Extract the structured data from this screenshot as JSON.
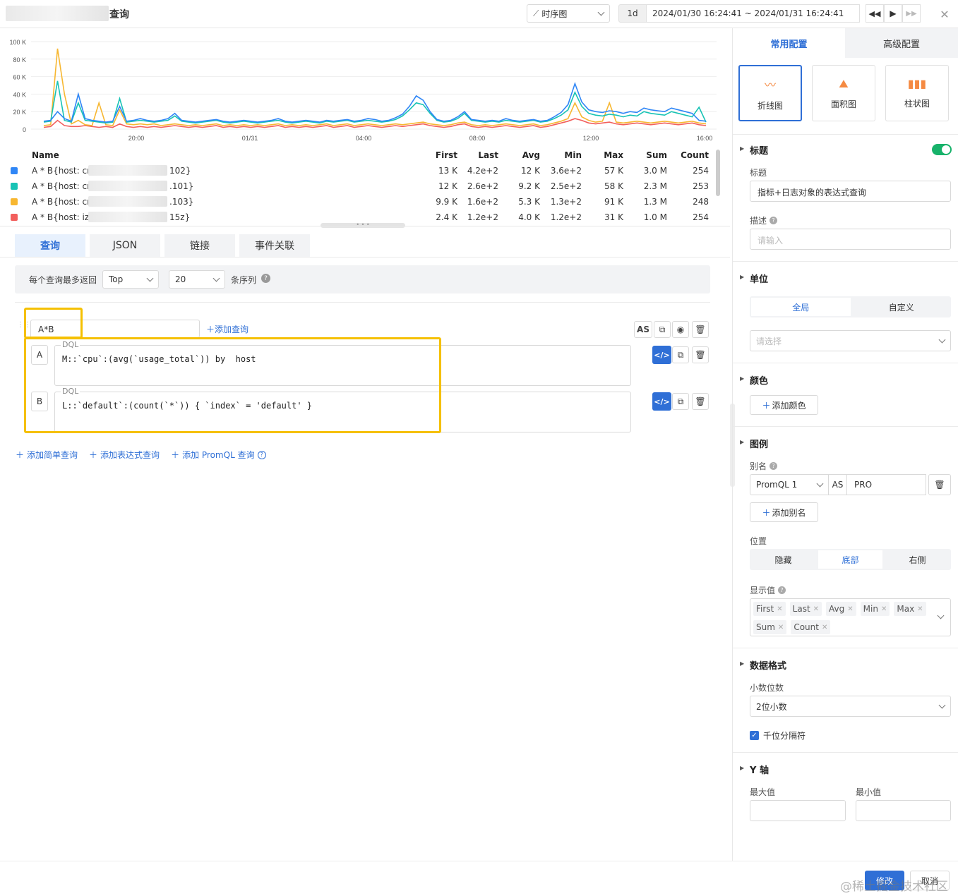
{
  "header": {
    "title": "查询",
    "chart_type": "时序图",
    "range_btn": "1d",
    "time_range": "2024/01/30 16:24:41 ~ 2024/01/31 16:24:41"
  },
  "chart_data": {
    "type": "line",
    "y_ticks": [
      "100 K",
      "80 K",
      "60 K",
      "40 K",
      "20 K",
      "0"
    ],
    "x_ticks": [
      "20:00",
      "01/31",
      "04:00",
      "08:00",
      "12:00",
      "16:00"
    ],
    "ylim": [
      0,
      100000
    ],
    "series": [
      {
        "color": "#2f86f6",
        "values": [
          9,
          10,
          20,
          12,
          9,
          40,
          12,
          10,
          9,
          8,
          9,
          26,
          9,
          10,
          12,
          10,
          9,
          10,
          12,
          18,
          10,
          9,
          8,
          9,
          10,
          11,
          9,
          8,
          9,
          10,
          9,
          8,
          9,
          10,
          12,
          9,
          8,
          9,
          10,
          9,
          8,
          10,
          9,
          10,
          11,
          9,
          10,
          12,
          11,
          9,
          10,
          13,
          17,
          26,
          38,
          33,
          20,
          11,
          9,
          10,
          14,
          20,
          11,
          10,
          9,
          10,
          9,
          12,
          10,
          9,
          10,
          11,
          9,
          10,
          14,
          19,
          28,
          52,
          31,
          22,
          20,
          19,
          21,
          20,
          18,
          20,
          19,
          24,
          22,
          21,
          20,
          24,
          22,
          20,
          18,
          10,
          9
        ]
      },
      {
        "color": "#18c3b5",
        "values": [
          8,
          9,
          55,
          10,
          8,
          30,
          10,
          9,
          8,
          7,
          8,
          35,
          8,
          9,
          10,
          9,
          8,
          9,
          10,
          15,
          9,
          8,
          7,
          8,
          9,
          10,
          8,
          7,
          8,
          9,
          8,
          7,
          8,
          9,
          10,
          8,
          7,
          8,
          9,
          8,
          7,
          9,
          8,
          9,
          10,
          8,
          9,
          10,
          9,
          8,
          9,
          11,
          15,
          22,
          30,
          28,
          18,
          10,
          8,
          9,
          12,
          18,
          10,
          9,
          8,
          9,
          8,
          10,
          9,
          8,
          9,
          10,
          8,
          9,
          12,
          16,
          22,
          42,
          26,
          18,
          16,
          15,
          17,
          16,
          14,
          16,
          15,
          20,
          18,
          17,
          16,
          20,
          18,
          16,
          14,
          25,
          8
        ]
      },
      {
        "color": "#f7b731",
        "values": [
          4,
          5,
          92,
          40,
          6,
          10,
          5,
          4,
          30,
          5,
          4,
          22,
          6,
          5,
          6,
          5,
          6,
          4,
          5,
          6,
          5,
          4,
          5,
          4,
          5,
          6,
          4,
          5,
          4,
          5,
          4,
          5,
          4,
          5,
          6,
          4,
          5,
          4,
          5,
          4,
          5,
          6,
          4,
          5,
          6,
          4,
          5,
          6,
          5,
          4,
          5,
          6,
          5,
          6,
          7,
          8,
          6,
          5,
          4,
          5,
          7,
          8,
          5,
          4,
          5,
          4,
          5,
          6,
          5,
          4,
          5,
          6,
          4,
          5,
          7,
          9,
          12,
          30,
          14,
          10,
          8,
          9,
          30,
          8,
          7,
          8,
          9,
          8,
          7,
          8,
          9,
          8,
          7,
          8,
          9,
          7,
          6
        ]
      },
      {
        "color": "#f25f5c",
        "values": [
          2,
          3,
          10,
          4,
          3,
          3,
          4,
          3,
          2,
          3,
          2,
          6,
          3,
          2,
          3,
          2,
          3,
          2,
          3,
          4,
          3,
          2,
          3,
          2,
          3,
          4,
          2,
          3,
          2,
          3,
          2,
          3,
          2,
          3,
          4,
          2,
          3,
          2,
          3,
          2,
          3,
          4,
          2,
          3,
          4,
          2,
          3,
          4,
          3,
          2,
          3,
          4,
          3,
          4,
          5,
          6,
          4,
          3,
          2,
          3,
          5,
          6,
          3,
          2,
          3,
          2,
          3,
          4,
          3,
          2,
          3,
          4,
          2,
          3,
          5,
          7,
          9,
          12,
          10,
          7,
          6,
          7,
          8,
          6,
          5,
          6,
          7,
          6,
          5,
          6,
          7,
          6,
          5,
          6,
          7,
          5,
          4
        ]
      }
    ]
  },
  "legend_table": {
    "headers": [
      "Name",
      "First",
      "Last",
      "Avg",
      "Min",
      "Max",
      "Sum",
      "Count"
    ],
    "rows": [
      {
        "color": "#2f86f6",
        "name_a": "A * B{host: cn-",
        "name_b": "102}",
        "first": "13 K",
        "last": "4.2e+2",
        "avg": "12 K",
        "min": "3.6e+2",
        "max": "57 K",
        "sum": "3.0 M",
        "count": "254"
      },
      {
        "color": "#18c3b5",
        "name_a": "A * B{host: cn-",
        "name_b": ".101}",
        "first": "12 K",
        "last": "2.6e+2",
        "avg": "9.2 K",
        "min": "2.5e+2",
        "max": "58 K",
        "sum": "2.3 M",
        "count": "253"
      },
      {
        "color": "#f7b731",
        "name_a": "A * B{host: cn-",
        "name_b": ".103}",
        "first": "9.9 K",
        "last": "1.6e+2",
        "avg": "5.3 K",
        "min": "1.3e+2",
        "max": "91 K",
        "sum": "1.3 M",
        "count": "248"
      },
      {
        "color": "#f25f5c",
        "name_a": "A * B{host: izbp",
        "name_b": "15z}",
        "first": "2.4 K",
        "last": "1.2e+2",
        "avg": "4.0 K",
        "min": "1.2e+2",
        "max": "31 K",
        "sum": "1.0 M",
        "count": "254"
      }
    ]
  },
  "tabs": [
    "查询",
    "JSON",
    "链接",
    "事件关联"
  ],
  "query_opts": {
    "label": "每个查询最多返回",
    "order": "Top",
    "limit": "20",
    "suffix": "条序列"
  },
  "expr": {
    "value": "A*B",
    "add_query": "添加查询",
    "as": "AS"
  },
  "queries": [
    {
      "letter": "A",
      "type": "DQL",
      "code": "M::`cpu`:(avg(`usage_total`)) by  host"
    },
    {
      "letter": "B",
      "type": "DQL",
      "code": "L::`default`:(count(`*`)) { `index` = 'default' }"
    }
  ],
  "add_links": [
    "添加简单查询",
    "添加表达式查询",
    "添加 PromQL 查询"
  ],
  "panel": {
    "tab_common": "常用配置",
    "tab_adv": "高级配置",
    "chart_types": [
      "折线图",
      "面积图",
      "柱状图"
    ],
    "title_section": "标题",
    "title_label": "标题",
    "title_value": "指标+日志对象的表达式查询",
    "desc_label": "描述",
    "desc_placeholder": "请输入",
    "unit_section": "单位",
    "unit_global": "全局",
    "unit_custom": "自定义",
    "unit_placeholder": "请选择",
    "color_section": "颜色",
    "add_color": "添加颜色",
    "legend_section": "图例",
    "alias_label": "别名",
    "alias_select": "PromQL 1",
    "alias_as": "AS",
    "alias_value": "PRO",
    "add_alias": "添加别名",
    "pos_label": "位置",
    "pos_options": [
      "隐藏",
      "底部",
      "右侧"
    ],
    "show_label": "显示值",
    "show_tags": [
      "First",
      "Last",
      "Avg",
      "Min",
      "Max",
      "Sum",
      "Count"
    ],
    "format_section": "数据格式",
    "decimal_label": "小数位数",
    "decimal_value": "2位小数",
    "thousands_label": "千位分隔符",
    "y_section": "Y 轴",
    "ymax_label": "最大值",
    "ymin_label": "最小值"
  },
  "footer": {
    "ok": "修改",
    "cancel": "取消",
    "watermark": "@稀土掘金技术社区"
  }
}
